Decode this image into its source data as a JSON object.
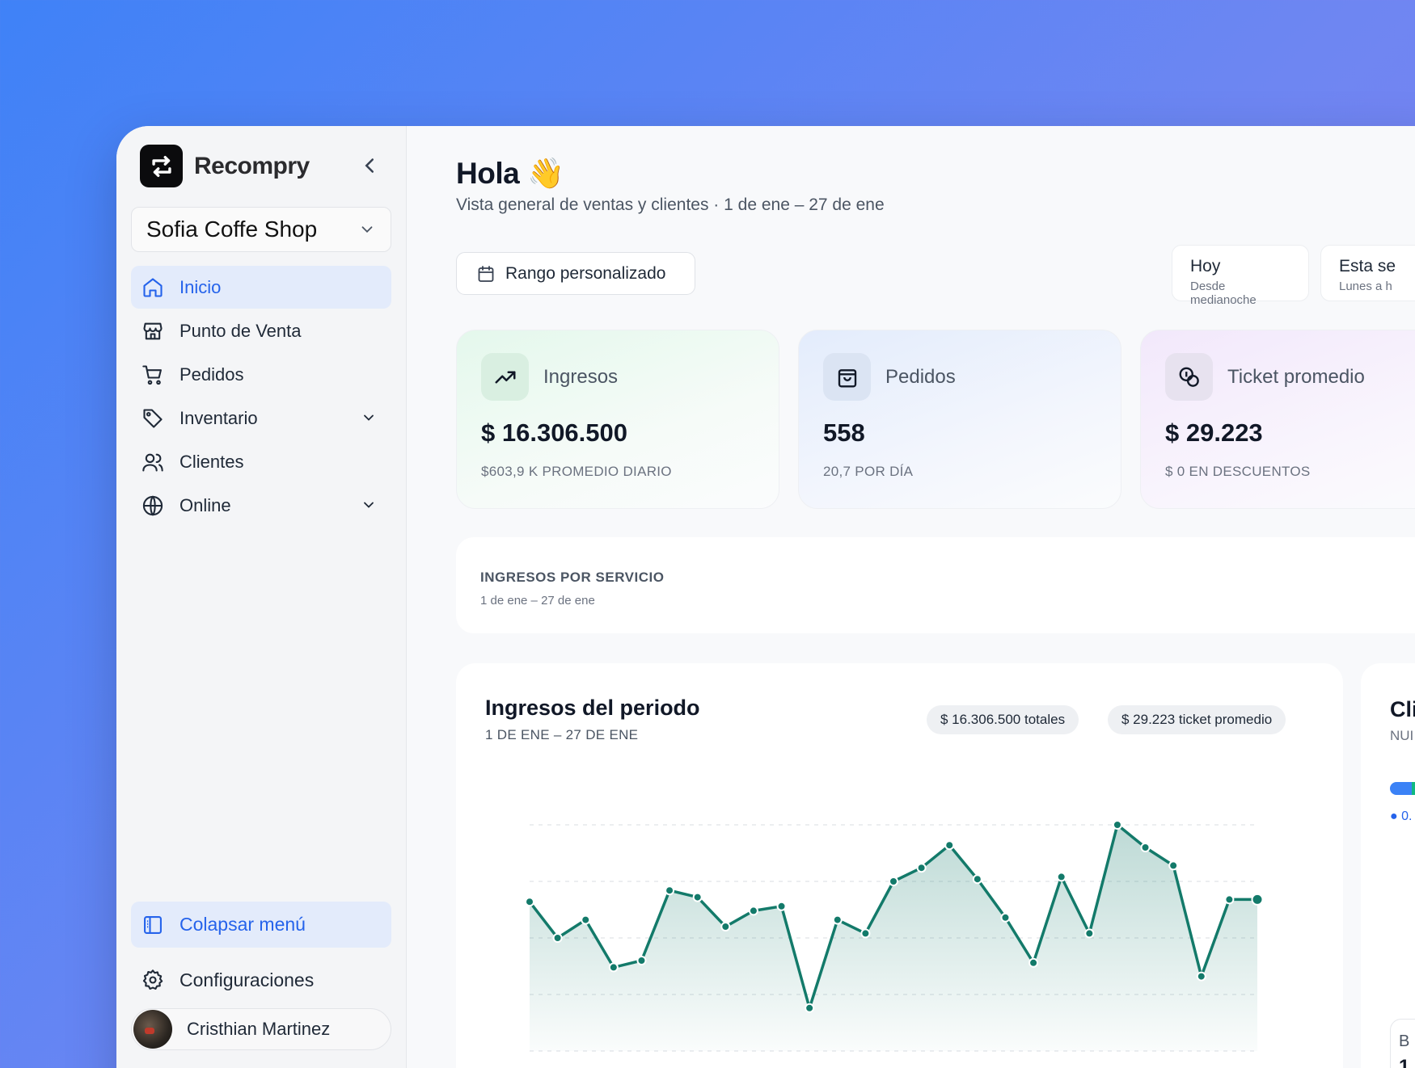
{
  "brand": {
    "name": "Recompry"
  },
  "shop": {
    "selected": "Sofia Coffe Shop"
  },
  "nav": [
    {
      "label": "Inicio",
      "icon": "home-icon",
      "active": true
    },
    {
      "label": "Punto de Venta",
      "icon": "store-icon"
    },
    {
      "label": "Pedidos",
      "icon": "cart-icon"
    },
    {
      "label": "Inventario",
      "icon": "tag-icon",
      "expandable": true
    },
    {
      "label": "Clientes",
      "icon": "users-icon"
    },
    {
      "label": "Online",
      "icon": "globe-icon",
      "expandable": true
    }
  ],
  "sidebar_footer": {
    "collapse_label": "Colapsar menú",
    "settings_label": "Configuraciones",
    "user_name": "Cristhian Martinez"
  },
  "header": {
    "greeting": "Hola",
    "wave": "👋",
    "subtitle": "Vista general de ventas y clientes · 1 de ene – 27 de ene"
  },
  "range_button": "Rango personalizado",
  "periods": [
    {
      "title": "Hoy",
      "sub": "Desde medianoche"
    },
    {
      "title": "Esta se",
      "sub": "Lunes a h"
    }
  ],
  "kpis": [
    {
      "title": "Ingresos",
      "value": "$ 16.306.500",
      "note": "$603,9 K PROMEDIO DIARIO",
      "icon": "trending-up-icon"
    },
    {
      "title": "Pedidos",
      "value": "558",
      "note": "20,7 POR DÍA",
      "icon": "shopping-bag-icon"
    },
    {
      "title": "Ticket promedio",
      "value": "$ 29.223",
      "note": "$ 0 EN DESCUENTOS",
      "icon": "coins-icon"
    }
  ],
  "service": {
    "title": "INGRESOS POR SERVICIO",
    "range": "1 de ene – 27 de ene"
  },
  "revenue_chart": {
    "title": "Ingresos del periodo",
    "range": "1 DE ENE – 27 DE ENE",
    "total_pill": "$ 16.306.500 totales",
    "avg_pill": "$ 29.223 ticket promedio"
  },
  "chart_data": {
    "type": "area",
    "title": "Ingresos del periodo",
    "x": [
      1,
      2,
      3,
      4,
      5,
      6,
      7,
      8,
      9,
      10,
      11,
      12,
      13,
      14,
      15,
      16,
      17,
      18,
      19,
      20,
      21,
      22,
      23,
      24,
      25,
      26,
      27
    ],
    "series": [
      {
        "values": [
          0.66,
          0.5,
          0.58,
          0.37,
          0.4,
          0.71,
          0.68,
          0.55,
          0.62,
          0.64,
          0.19,
          0.58,
          0.52,
          0.75,
          0.81,
          0.91,
          0.76,
          0.59,
          0.39,
          0.77,
          0.52,
          1.0,
          0.9,
          0.82,
          0.33,
          0.67,
          0.67
        ]
      }
    ],
    "ylim": [
      0,
      1.0
    ],
    "grid": true,
    "color": "#137a6a"
  },
  "clients_card": {
    "title": "Cli",
    "sub": "NUI",
    "legend": "● 0.",
    "box_a": "B",
    "box_b": "1"
  }
}
